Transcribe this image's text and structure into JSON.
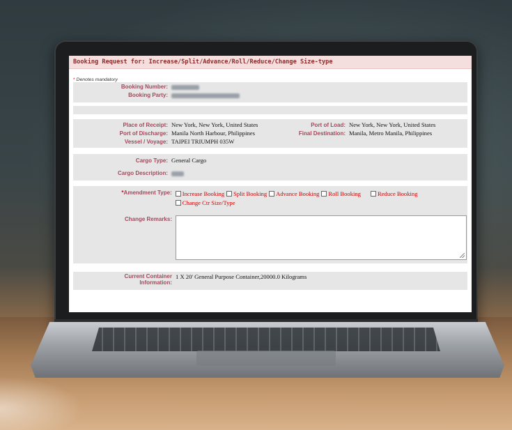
{
  "form": {
    "title": "Booking Request for: Increase/Split/Advance/Roll/Reduce/Change Size-type",
    "mandatory_star": "*",
    "mandatory_note": "Denotes mandatory",
    "booking_number_label": "Booking Number:",
    "booking_party_label": "Booking Party:",
    "place_of_receipt_label": "Place of Receipt:",
    "place_of_receipt_value": "New York, New York, United States",
    "port_of_load_label": "Port of Load:",
    "port_of_load_value": "New York, New York, United States",
    "port_of_discharge_label": "Port of Discharge:",
    "port_of_discharge_value": "Manila North Harbour, Philippines",
    "final_destination_label": "Final Destination:",
    "final_destination_value": "Manila, Metro Manila, Philippines",
    "vessel_voyage_label": "Vessel / Voyage:",
    "vessel_voyage_value": "TAIPEI TRIUMPH 035W",
    "cargo_type_label": "Cargo Type:",
    "cargo_type_value": "General Cargo",
    "cargo_description_label": "Cargo Description:",
    "amendment_type_star": "*",
    "amendment_type_label": "Amendment Type:",
    "amendment_options": [
      "Increase Booking",
      "Split Booking",
      "Advance Booking",
      "Roll Booking",
      "Reduce Booking",
      "Change Ctr Size/Type"
    ],
    "change_remarks_label": "Change Remarks:",
    "change_remarks_value": "",
    "current_container_label_1": "Current Container",
    "current_container_label_2": "Information:",
    "current_container_value": "1 X 20' General Purpose Container,20000.0 Kilograms"
  }
}
